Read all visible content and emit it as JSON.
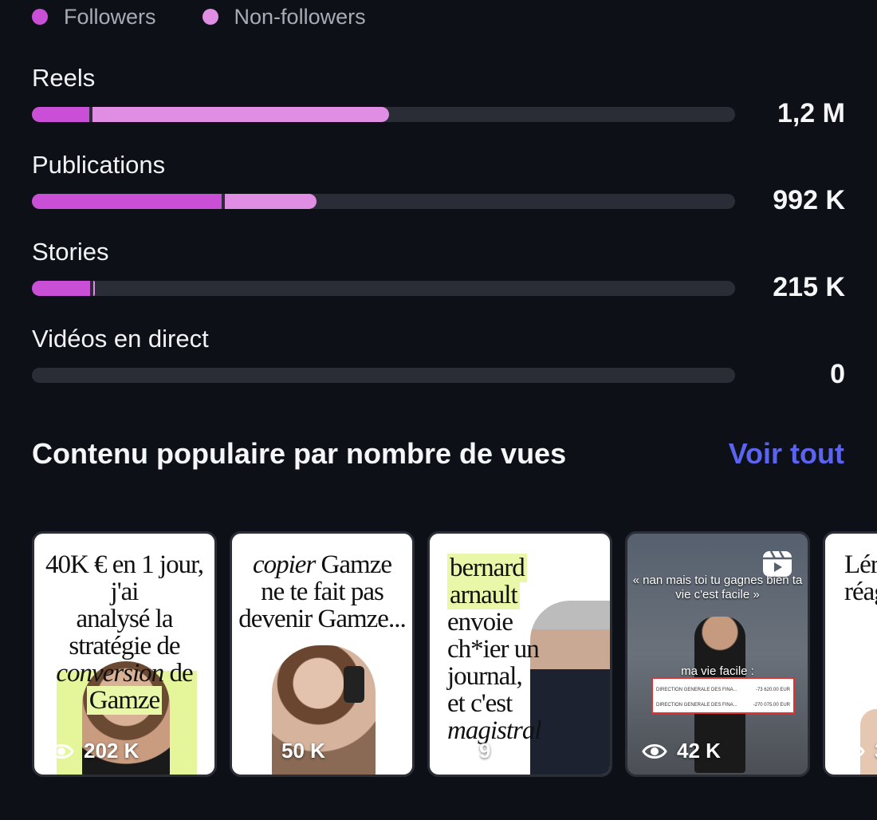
{
  "legend": [
    {
      "label": "Followers",
      "color": "#c84fd6"
    },
    {
      "label": "Non-followers",
      "color": "#e08ee3"
    }
  ],
  "metrics": [
    {
      "label": "Reels",
      "value": "1,2 M",
      "followers_fraction": 0.082,
      "nonfollowers_fraction": 0.426
    },
    {
      "label": "Publications",
      "value": "992 K",
      "followers_fraction": 0.27,
      "nonfollowers_fraction": 0.135
    },
    {
      "label": "Stories",
      "value": "215 K",
      "followers_fraction": 0.083,
      "nonfollowers_fraction": 0.003
    },
    {
      "label": "Vidéos en direct",
      "value": "0",
      "followers_fraction": 0,
      "nonfollowers_fraction": 0
    }
  ],
  "popular": {
    "title": "Contenu populaire par nombre de vues",
    "see_all": "Voir tout"
  },
  "cards": [
    {
      "views": "202 K",
      "icon": "eye-icon"
    },
    {
      "views": "50 K",
      "icon": "eye-icon"
    },
    {
      "views": "9",
      "icon": "eye-icon"
    },
    {
      "views": "42 K",
      "icon": "eye-icon",
      "caption_top": "« nan mais toi tu gagnes bien ta vie c'est facile »",
      "caption_mid": "ma vie facile :",
      "doc_rows": [
        {
          "label": "DIRECTION GENERALE DES FINA...",
          "amount": "-73 620.00 EUR"
        },
        {
          "label": "DIRECTION GENERALE DES FINA...",
          "amount": "-270 075.00 EUR"
        }
      ]
    },
    {
      "views": "3",
      "icon": "eye-icon"
    }
  ]
}
